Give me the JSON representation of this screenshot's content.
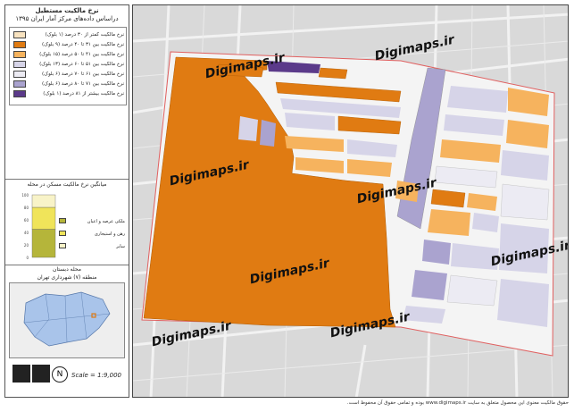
{
  "panel": {
    "title": "نرخ مالکیت مستطیل",
    "subtitle": "دراساس داده‌های مرکز آمار ایران ۱۳۹۵",
    "legend": [
      {
        "label": "نرخ مالکیت کمتر از ۳۰ درصد (۱ بلوک)",
        "color": "#f8e3c0"
      },
      {
        "label": "نرخ مالکیت بین ۳۱ تا ۴۰ درصد (۹ بلوک)",
        "color": "#e07b12"
      },
      {
        "label": "نرخ مالکیت بین ۴۱ تا ۵۰ درصد (۱۵ بلوک)",
        "color": "#f6b35e"
      },
      {
        "label": "نرخ مالکیت بین ۵۱ تا ۶۰ درصد (۱۳ بلوک)",
        "color": "#d6d4e8"
      },
      {
        "label": "نرخ مالکیت بین ۶۱ تا ۷۰ درصد (۶ بلوک)",
        "color": "#ecebf3"
      },
      {
        "label": "نرخ مالکیت بین ۷۱ تا ۸۰ درصد (۶ بلوک)",
        "color": "#aaa3cf"
      },
      {
        "label": "نرخ مالکیت بیشتر از ۸۱ درصد (۱ بلوک)",
        "color": "#5b3a8a"
      }
    ],
    "chart_title": "میانگین نرخ مالکیت مسکن در محله",
    "chart_legend": [
      {
        "label": "ملکی عرصه و اعیان",
        "color": "#b5b53a"
      },
      {
        "label": "رهن و استیجاری",
        "color": "#f0e45a"
      },
      {
        "label": "سایر",
        "color": "#f8f3c8"
      }
    ],
    "place_name": "محله دبستان",
    "place_region": "منطقه (۷) شهرداری تهران",
    "scale": "Scale = 1:9,000"
  },
  "watermark": "Digimaps.ir",
  "footer": "حقوق مالکیت معنوی این محصول متعلق به سایت www.digimaps.ir بوده و تمامی حقوق آن محفوظ است.",
  "chart_data": {
    "type": "bar",
    "categories": [
      "محله دبستان"
    ],
    "series": [
      {
        "name": "ملکی عرصه و اعیان",
        "values": [
          45
        ]
      },
      {
        "name": "رهن و استیجاری",
        "values": [
          35
        ]
      },
      {
        "name": "سایر",
        "values": [
          20
        ]
      }
    ],
    "ylim": [
      0,
      100
    ],
    "yticks": [
      "0",
      "20",
      "40",
      "60",
      "80",
      "100"
    ]
  }
}
